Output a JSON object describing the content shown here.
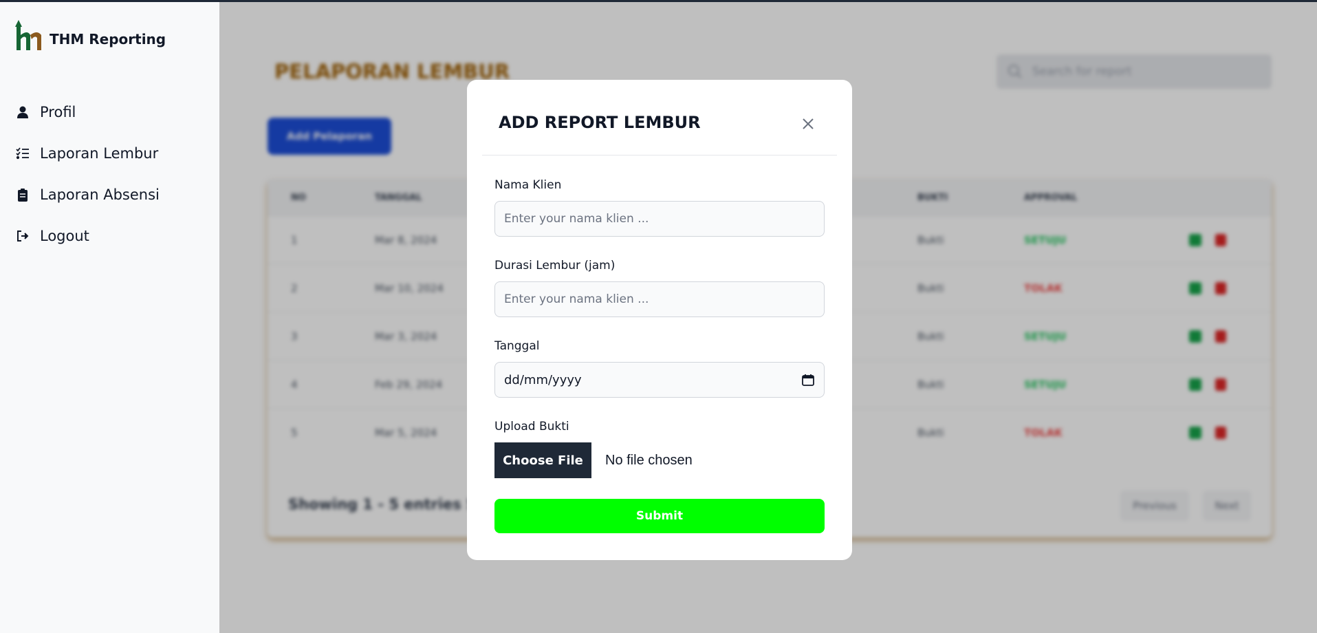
{
  "brand": {
    "name": "THM Reporting",
    "logo_icon": "thm-logo"
  },
  "sidebar": {
    "items": [
      {
        "label": "Profil",
        "icon": "user-icon"
      },
      {
        "label": "Laporan Lembur",
        "icon": "checklist-icon"
      },
      {
        "label": "Laporan Absensi",
        "icon": "clipboard-icon"
      },
      {
        "label": "Logout",
        "icon": "logout-icon"
      }
    ]
  },
  "page": {
    "title": "PELAPORAN LEMBUR",
    "search_placeholder": "Search for report",
    "add_button": "Add Pelaporan",
    "table": {
      "headers": [
        "NO",
        "TANGGAL",
        "BUKTI",
        "APPROVAL"
      ],
      "rows": [
        {
          "no": "1",
          "date": "Mar 8, 2024",
          "bukti": "Bukti",
          "approval": "SETUJU",
          "status": "approved"
        },
        {
          "no": "2",
          "date": "Mar 10, 2024",
          "bukti": "Bukti",
          "approval": "TOLAK",
          "status": "rejected"
        },
        {
          "no": "3",
          "date": "Mar 3, 2024",
          "bukti": "Bukti",
          "approval": "SETUJU",
          "status": "approved"
        },
        {
          "no": "4",
          "date": "Feb 29, 2024",
          "bukti": "Bukti",
          "approval": "SETUJU",
          "status": "approved"
        },
        {
          "no": "5",
          "date": "Mar 5, 2024",
          "bukti": "Bukti",
          "approval": "TOLAK",
          "status": "rejected"
        }
      ]
    },
    "showing": "Showing 1 - 5 entries 5",
    "pagination": {
      "prev": "Previous",
      "next": "Next"
    }
  },
  "modal": {
    "title": "ADD REPORT LEMBUR",
    "fields": {
      "nama_klien": {
        "label": "Nama Klien",
        "placeholder": "Enter your nama klien ..."
      },
      "durasi": {
        "label": "Durasi Lembur (jam)",
        "placeholder": "Enter your nama klien ..."
      },
      "tanggal": {
        "label": "Tanggal",
        "value": "dd/mm/yyyy"
      },
      "upload": {
        "label": "Upload Bukti",
        "button": "Choose File",
        "status": "No file chosen"
      }
    },
    "submit": "Submit"
  },
  "colors": {
    "approved": "#22c55e",
    "rejected": "#ef4444",
    "submit": "#00ff00",
    "title_accent": "#a16207",
    "primary": "#1d4ed8"
  }
}
